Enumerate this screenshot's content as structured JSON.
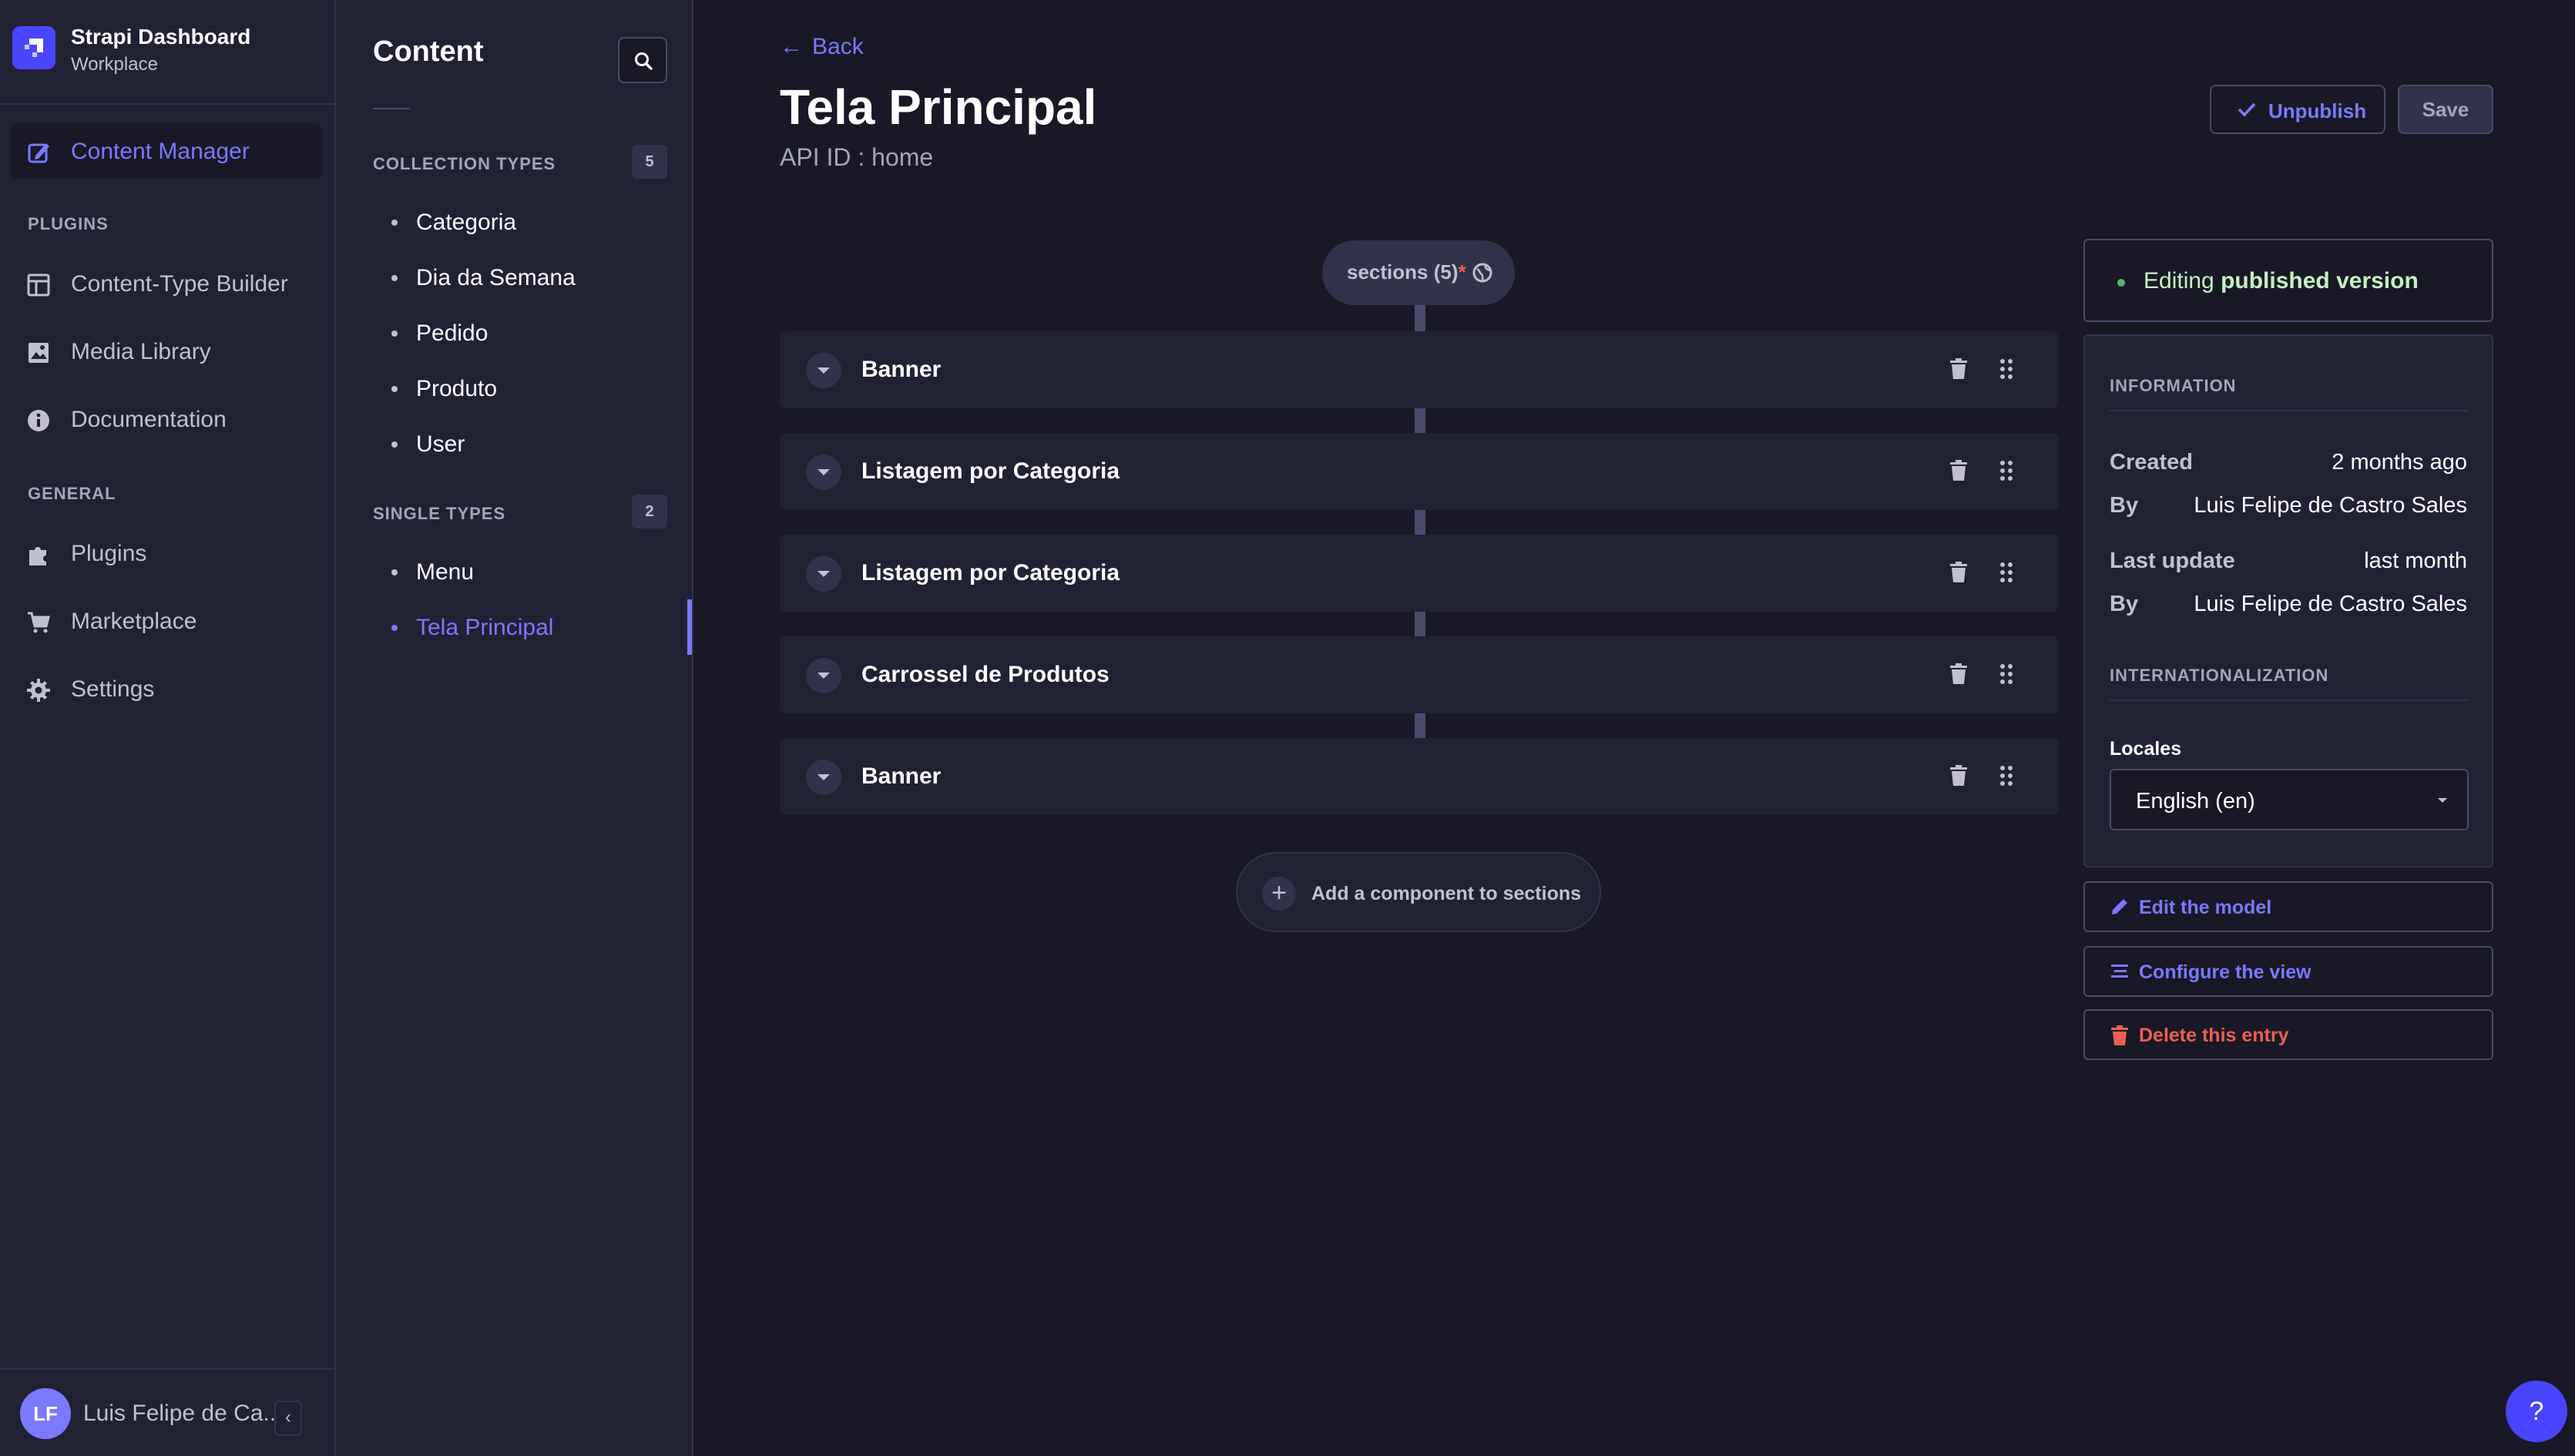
{
  "brand": {
    "title": "Strapi Dashboard",
    "subtitle": "Workplace"
  },
  "mainnav": {
    "active": "Content Manager",
    "content_manager": "Content Manager",
    "plugins_heading": "PLUGINS",
    "plugins": [
      "Content-Type Builder",
      "Media Library",
      "Documentation"
    ],
    "general_heading": "GENERAL",
    "general": [
      "Plugins",
      "Marketplace",
      "Settings"
    ]
  },
  "user": {
    "initials": "LF",
    "name": "Luis Felipe de Ca..."
  },
  "subnav": {
    "title": "Content",
    "collection_heading": "COLLECTION TYPES",
    "collection_count": "5",
    "collection_types": [
      "Categoria",
      "Dia da Semana",
      "Pedido",
      "Produto",
      "User"
    ],
    "single_heading": "SINGLE TYPES",
    "single_count": "2",
    "single_types": [
      "Menu",
      "Tela Principal"
    ],
    "active": "Tela Principal"
  },
  "header": {
    "back": "Back",
    "title": "Tela Principal",
    "api_id": "API ID : home",
    "unpublish": "Unpublish",
    "save": "Save"
  },
  "dynamic_zone": {
    "label": "sections (5)",
    "required_mark": "*",
    "components": [
      "Banner",
      "Listagem por Categoria",
      "Listagem por Categoria",
      "Carrossel de Produtos",
      "Banner"
    ],
    "add_label": "Add a component to sections"
  },
  "status": {
    "prefix": "Editing",
    "emphasis": "published version"
  },
  "information": {
    "heading": "INFORMATION",
    "created_label": "Created",
    "created_value": "2 months ago",
    "created_by_label": "By",
    "created_by_value": "Luis Felipe de Castro Sales",
    "updated_label": "Last update",
    "updated_value": "last month",
    "updated_by_label": "By",
    "updated_by_value": "Luis Felipe de Castro Sales"
  },
  "i18n": {
    "heading": "INTERNATIONALIZATION",
    "locales_label": "Locales",
    "locale_selected": "English (en)"
  },
  "actions": {
    "edit_model": "Edit the model",
    "configure_view": "Configure the view",
    "delete_entry": "Delete this entry"
  },
  "help": {
    "label": "?"
  },
  "colors": {
    "accent": "#7b79ff",
    "brand": "#4945ff",
    "danger": "#ee5e52",
    "success": "#5cb176",
    "background": "#181826",
    "surface": "#212134"
  }
}
